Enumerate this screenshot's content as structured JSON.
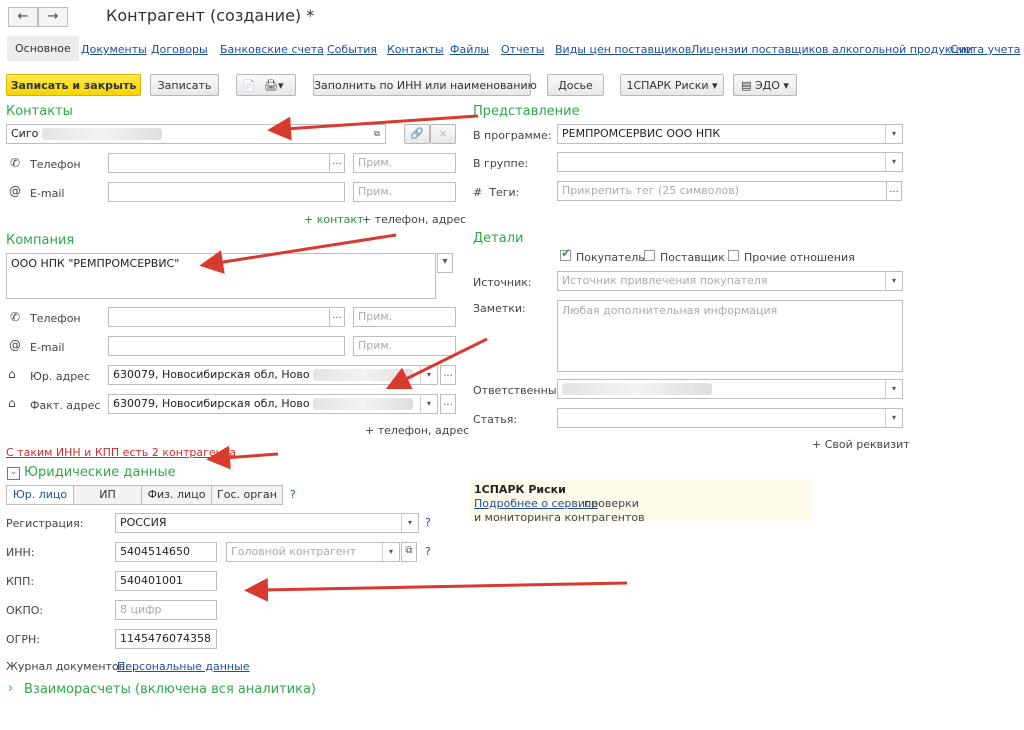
{
  "window": {
    "title": "Контрагент (создание) *",
    "back_icon": "←",
    "forward_icon": "→"
  },
  "tabs": [
    "Основное",
    "Документы",
    "Договоры",
    "Банковские счета",
    "События",
    "Контакты",
    "Файлы",
    "Отчеты",
    "Виды цен поставщиков",
    "Лицензии поставщиков алкогольной продукции",
    "Счета учета"
  ],
  "toolbar": {
    "save_close": "Записать и закрыть",
    "save": "Записать",
    "fill_inn": "Заполнить по ИНН или наименованию",
    "dossier": "Досье",
    "spark": "1СПАРК Риски",
    "edo": "ЭДО"
  },
  "contacts": {
    "title": "Контакты",
    "name_value": "Сиго",
    "phone_label": "Телефон",
    "email_label": "E-mail",
    "note_placeholder": "Прим.",
    "add_contact": "+ контакт",
    "add_phone_address": "+ телефон, адрес"
  },
  "company": {
    "title": "Компания",
    "name": "ООО НПК \"РЕМПРОМСЕРВИС\"",
    "phone_label": "Телефон",
    "email_label": "E-mail",
    "legal_address_label": "Юр. адрес",
    "legal_address": "630079, Новосибирская обл, Ново",
    "actual_address_label": "Факт. адрес",
    "actual_address": "630079, Новосибирская обл, Ново",
    "note_placeholder": "Прим.",
    "add_phone_address": "+ телефон, адрес",
    "duplicate_warning": "С таким ИНН и КПП есть 2 контрагента"
  },
  "legal": {
    "title": "Юридические данные",
    "types": [
      "Юр. лицо",
      "ИП",
      "Физ. лицо",
      "Гос. орган"
    ],
    "registration_label": "Регистрация:",
    "registration_value": "РОССИЯ",
    "inn_label": "ИНН:",
    "inn_value": "5404514650",
    "head_placeholder": "Головной контрагент",
    "kpp_label": "КПП:",
    "kpp_value": "540401001",
    "okpo_label": "ОКПО:",
    "okpo_placeholder": "8 цифр",
    "ogrn_label": "ОГРН:",
    "ogrn_value": "1145476074358",
    "journal_label": "Журнал документов:",
    "journal_link": "Персональные данные",
    "help": "?"
  },
  "settlements": {
    "title": "Взаиморасчеты (включена вся аналитика)"
  },
  "presentation": {
    "title": "Представление",
    "program_label": "В программе:",
    "program_value": "РЕМПРОМСЕРВИС ООО НПК",
    "group_label": "В группе:",
    "tags_label": "Теги:",
    "tags_placeholder": "Прикрепить тег (25 символов)"
  },
  "details": {
    "title": "Детали",
    "buyer_label": "Покупатель",
    "buyer_checked": true,
    "supplier_label": "Поставщик",
    "other_label": "Прочие отношения",
    "source_label": "Источник:",
    "source_placeholder": "Источник привлечения покупателя",
    "notes_label": "Заметки:",
    "notes_placeholder": "Любая дополнительная информация",
    "responsible_label": "Ответственный:",
    "article_label": "Статья:",
    "add_attr": "+ Свой реквизит"
  },
  "spark_panel": {
    "title": "1СПАРК Риски",
    "link": "Подробнее о сервисе",
    "text1": " проверки",
    "text2": "и мониторинга контрагентов"
  },
  "annotation_color": "#d93a2f"
}
